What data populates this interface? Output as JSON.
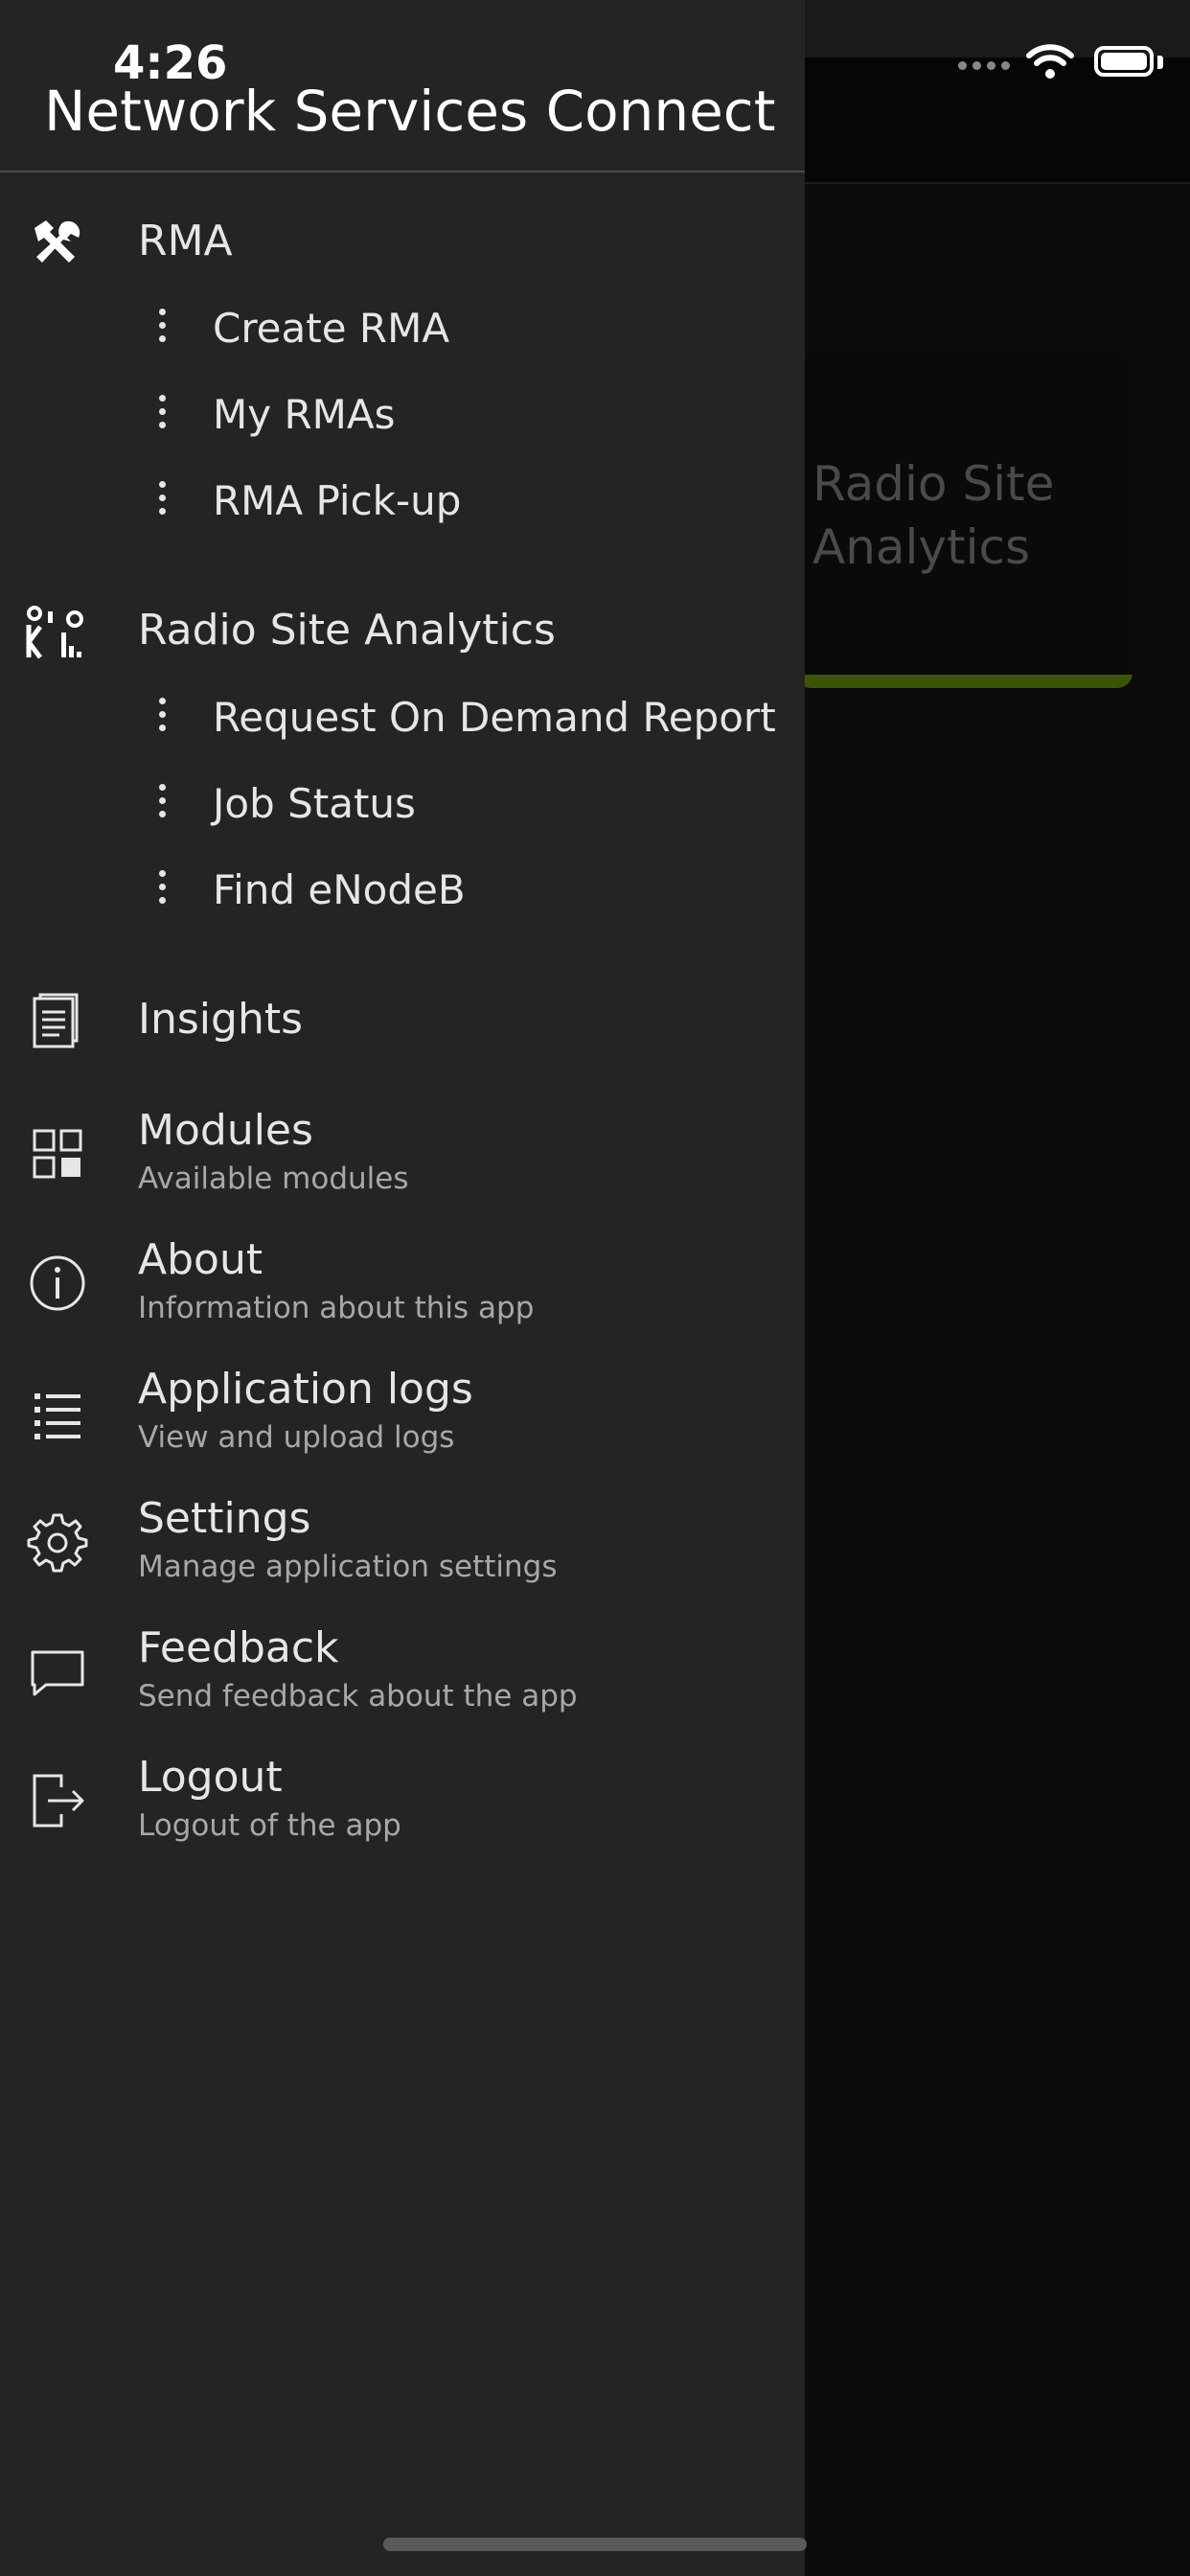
{
  "status_bar": {
    "time": "4:26"
  },
  "background": {
    "card_label": "Radio Site Analytics",
    "accent_color": "#3c5407"
  },
  "drawer": {
    "title": "Network Services Connect",
    "rma": {
      "label": "RMA",
      "icon": "tools-icon",
      "items": [
        "Create RMA",
        "My RMAs",
        "RMA Pick-up"
      ]
    },
    "radio": {
      "label": "Radio Site Analytics",
      "icon": "site-analytics-icon",
      "items": [
        "Request On Demand Report",
        "Job Status",
        "Find eNodeB"
      ]
    },
    "insights": {
      "label": "Insights",
      "icon": "document-icon"
    },
    "modules": {
      "title": "Modules",
      "subtitle": "Available modules",
      "icon": "modules-grid-icon"
    },
    "about": {
      "title": "About",
      "subtitle": "Information about this app",
      "icon": "info-icon"
    },
    "logs": {
      "title": "Application logs",
      "subtitle": "View and upload logs",
      "icon": "list-icon"
    },
    "settings": {
      "title": "Settings",
      "subtitle": "Manage application settings",
      "icon": "gear-icon"
    },
    "feedback": {
      "title": "Feedback",
      "subtitle": "Send feedback about the app",
      "icon": "chat-icon"
    },
    "logout": {
      "title": "Logout",
      "subtitle": "Logout of the app",
      "icon": "logout-icon"
    }
  }
}
